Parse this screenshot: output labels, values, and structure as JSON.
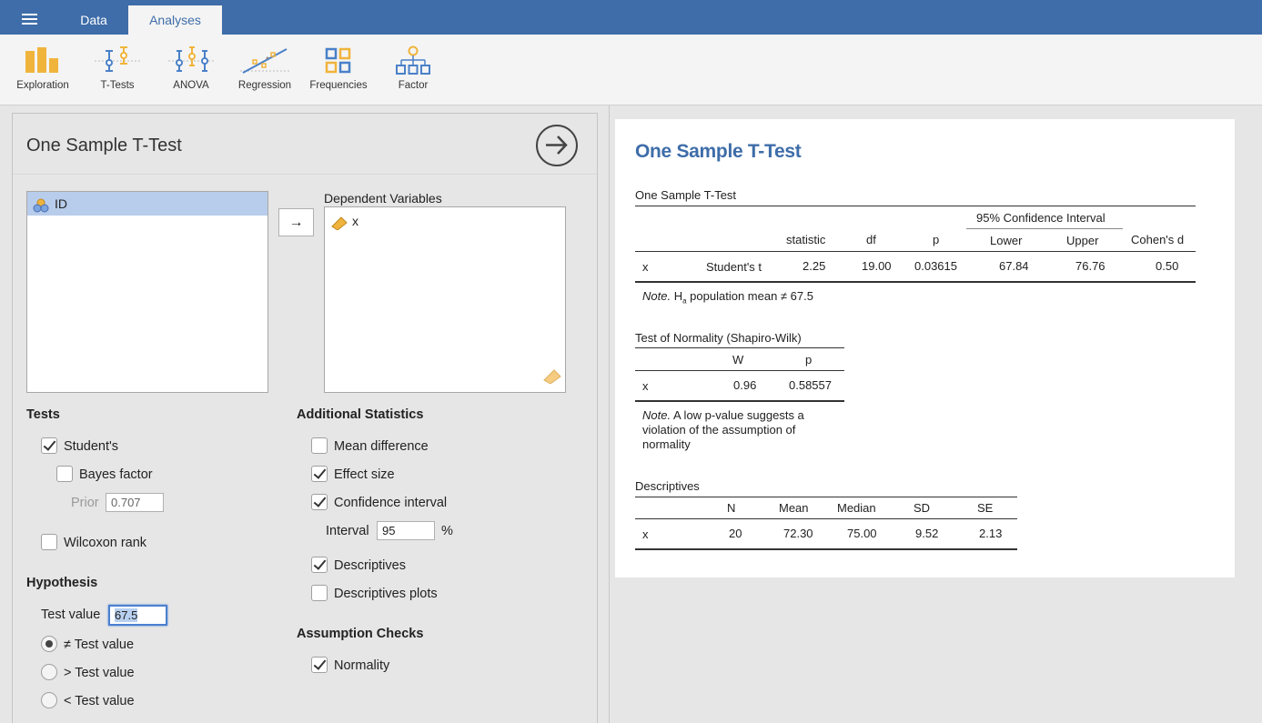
{
  "topbar": {
    "tabs": [
      {
        "label": "Data",
        "active": false
      },
      {
        "label": "Analyses",
        "active": true
      }
    ],
    "colors": {
      "bar": "#3e6da9"
    }
  },
  "ribbon": {
    "items": [
      {
        "label": "Exploration",
        "icon": "exploration-icon"
      },
      {
        "label": "T-Tests",
        "icon": "t-tests-icon"
      },
      {
        "label": "ANOVA",
        "icon": "anova-icon"
      },
      {
        "label": "Regression",
        "icon": "regression-icon"
      },
      {
        "label": "Frequencies",
        "icon": "frequencies-icon"
      },
      {
        "label": "Factor",
        "icon": "factor-icon"
      }
    ]
  },
  "options": {
    "title": "One Sample T-Test",
    "available_vars": [
      "ID"
    ],
    "dependent_label": "Dependent Variables",
    "dependent_vars": [
      "x"
    ],
    "move_arrow": "→",
    "tests": {
      "heading": "Tests",
      "students": {
        "label": "Student's",
        "checked": true
      },
      "bayes": {
        "label": "Bayes factor",
        "checked": false
      },
      "prior": {
        "label": "Prior",
        "value": "0.707"
      },
      "wilcoxon": {
        "label": "Wilcoxon rank",
        "checked": false
      }
    },
    "hypothesis": {
      "heading": "Hypothesis",
      "test_value_label": "Test value",
      "test_value": "67.5",
      "options": [
        {
          "label": "≠ Test value",
          "selected": true
        },
        {
          "label": "> Test value",
          "selected": false
        },
        {
          "label": "< Test value",
          "selected": false
        }
      ]
    },
    "additional": {
      "heading": "Additional Statistics",
      "mean_diff": {
        "label": "Mean difference",
        "checked": false
      },
      "effect_size": {
        "label": "Effect size",
        "checked": true
      },
      "conf_int": {
        "label": "Confidence interval",
        "checked": true
      },
      "interval_label": "Interval",
      "interval_value": "95",
      "interval_unit": "%",
      "descriptives": {
        "label": "Descriptives",
        "checked": true
      },
      "desc_plots": {
        "label": "Descriptives plots",
        "checked": false
      }
    },
    "assumption": {
      "heading": "Assumption Checks",
      "normality": {
        "label": "Normality",
        "checked": true
      }
    }
  },
  "results": {
    "title": "One Sample T-Test",
    "ttest": {
      "caption": "One Sample T-Test",
      "ci_header": "95% Confidence Interval",
      "headers": [
        "statistic",
        "df",
        "p",
        "Lower",
        "Upper",
        "Cohen's d"
      ],
      "row": {
        "var": "x",
        "test": "Student's t",
        "statistic": "2.25",
        "df": "19.00",
        "p": "0.03615",
        "lower": "67.84",
        "upper": "76.76",
        "d": "0.50"
      },
      "note_label": "Note.",
      "note_h": "H",
      "note_sub": "a",
      "note_text": "population mean ≠ 67.5"
    },
    "normality": {
      "caption": "Test of Normality (Shapiro-Wilk)",
      "headers": [
        "W",
        "p"
      ],
      "row": {
        "var": "x",
        "W": "0.96",
        "p": "0.58557"
      },
      "note_label": "Note.",
      "note_line1": "A low p-value suggests a",
      "note_line2": "violation of the assumption of",
      "note_line3": "normality"
    },
    "descriptives": {
      "caption": "Descriptives",
      "headers": [
        "N",
        "Mean",
        "Median",
        "SD",
        "SE"
      ],
      "row": {
        "var": "x",
        "N": "20",
        "Mean": "72.30",
        "Median": "75.00",
        "SD": "9.52",
        "SE": "2.13"
      }
    }
  }
}
